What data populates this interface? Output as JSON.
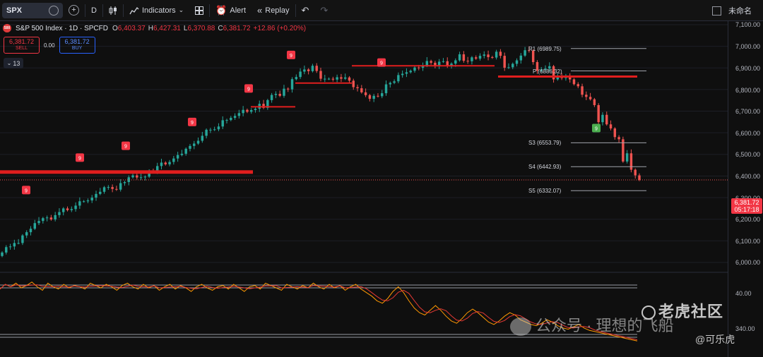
{
  "toolbar": {
    "symbol": "SPX",
    "interval": "D",
    "indicators_label": "Indicators",
    "alert_label": "Alert",
    "replay_label": "Replay",
    "layout_name": "未命名"
  },
  "legend": {
    "logo_text": "500",
    "title": "S&P 500 Index · 1D · SPCFD",
    "open_key": "O",
    "open": "6,403.37",
    "high_key": "H",
    "high": "6,427.31",
    "low_key": "L",
    "low": "6,370.88",
    "close_key": "C",
    "close": "6,381.72",
    "change": "+12.86 (+0.20%)",
    "sell_price": "6,381.72",
    "sell_label": "SELL",
    "spread": "0.00",
    "buy_price": "6,381.72",
    "buy_label": "BUY",
    "indicator_count": "13"
  },
  "price_axis": {
    "labels": [
      "7,100.00",
      "7,000.00",
      "6,900.00",
      "6,800.00",
      "6,700.00",
      "6,600.00",
      "6,500.00",
      "6,400.00",
      "6,300.00",
      "6,200.00",
      "6,100.00",
      "6,000.00"
    ],
    "current_price": "6,381.72",
    "countdown": "05:17:18"
  },
  "oscillator_axis": {
    "labels": [
      "40.00",
      "340.00"
    ]
  },
  "pivots": {
    "r1": "R1 (6989.75)",
    "p": "P (6886.32)",
    "s3": "S3 (6553.79)",
    "s4": "S4 (6442.93)",
    "s5": "S5 (6332.07)"
  },
  "signal_marker": "9",
  "watermark": {
    "main": "老虎社区",
    "sub": "公众号 · 理想的飞船",
    "author": "@可乐虎"
  },
  "colors": {
    "up": "#26a69a",
    "down": "#ef5350",
    "level_red": "#e01e1e",
    "signal_red": "#f23645",
    "signal_green": "#4caf50",
    "osc_orange": "#ff9800",
    "osc_red": "#e53935"
  },
  "chart_data": {
    "type": "candlestick",
    "series": [
      {
        "name": "SPX",
        "o": [
          6030,
          6046,
          6071,
          6074,
          6090,
          6090,
          6125,
          6140,
          6156,
          6182,
          6192,
          6205,
          6208,
          6199,
          6219,
          6233,
          6250,
          6242,
          6247,
          6263,
          6283,
          6283,
          6287,
          6300,
          6317,
          6327,
          6348,
          6349,
          6340,
          6337,
          6367,
          6372,
          6394,
          6403,
          6393,
          6394,
          6397,
          6422,
          6421,
          6446,
          6462,
          6454,
          6465,
          6481,
          6497,
          6503,
          6526,
          6539,
          6550,
          6563,
          6586,
          6614,
          6614,
          6616,
          6629,
          6658,
          6659,
          6669,
          6678,
          6691,
          6706,
          6697,
          6705,
          6711,
          6734,
          6715,
          6751,
          6775,
          6780,
          6771,
          6804,
          6801,
          6848,
          6858,
          6883,
          6893,
          6885,
          6910,
          6886,
          6850,
          6850,
          6850,
          6846,
          6857,
          6850,
          6856,
          6841,
          6811,
          6806,
          6787,
          6774,
          6757,
          6771,
          6769,
          6783,
          6824,
          6831,
          6838,
          6867,
          6873,
          6880,
          6887,
          6902,
          6901,
          6910,
          6932,
          6924,
          6910,
          6929,
          6931,
          6909,
          6920,
          6935,
          6963,
          6933,
          6931,
          6949,
          6943,
          6956,
          6962,
          6950,
          6948,
          6975,
          6956,
          6901,
          6903,
          6919,
          6935,
          6957,
          6982,
          6980,
          6927,
          6887,
          6892,
          6897,
          6908,
          6847,
          6864,
          6853,
          6857,
          6847,
          6825,
          6815,
          6776,
          6766,
          6755,
          6728,
          6649,
          6683,
          6639,
          6620,
          6580,
          6570,
          6467,
          6505,
          6429,
          6403
        ],
        "c": [
          6046,
          6071,
          6074,
          6090,
          6090,
          6125,
          6140,
          6156,
          6182,
          6192,
          6205,
          6208,
          6199,
          6219,
          6233,
          6250,
          6242,
          6247,
          6263,
          6283,
          6283,
          6287,
          6300,
          6317,
          6327,
          6348,
          6349,
          6340,
          6337,
          6367,
          6372,
          6394,
          6403,
          6393,
          6394,
          6397,
          6422,
          6421,
          6446,
          6462,
          6454,
          6465,
          6481,
          6497,
          6503,
          6526,
          6539,
          6550,
          6563,
          6586,
          6614,
          6614,
          6616,
          6629,
          6658,
          6659,
          6669,
          6678,
          6691,
          6706,
          6697,
          6705,
          6711,
          6734,
          6715,
          6751,
          6775,
          6780,
          6771,
          6804,
          6801,
          6848,
          6858,
          6883,
          6893,
          6885,
          6910,
          6886,
          6850,
          6850,
          6850,
          6846,
          6857,
          6850,
          6856,
          6841,
          6811,
          6806,
          6787,
          6774,
          6757,
          6771,
          6769,
          6783,
          6824,
          6831,
          6838,
          6867,
          6873,
          6880,
          6887,
          6902,
          6901,
          6910,
          6932,
          6924,
          6910,
          6929,
          6931,
          6909,
          6920,
          6935,
          6963,
          6933,
          6931,
          6949,
          6943,
          6956,
          6962,
          6950,
          6948,
          6975,
          6956,
          6901,
          6903,
          6919,
          6935,
          6957,
          6982,
          6980,
          6927,
          6887,
          6892,
          6897,
          6908,
          6847,
          6864,
          6853,
          6857,
          6847,
          6825,
          6815,
          6776,
          6766,
          6755,
          6728,
          6649,
          6683,
          6639,
          6620,
          6580,
          6570,
          6467,
          6505,
          6429,
          6403,
          6382
        ]
      },
      {
        "name": "oscillator",
        "values": [
          58,
          62,
          60,
          63,
          59,
          61,
          64,
          60,
          57,
          63,
          60,
          58,
          62,
          59,
          61,
          60,
          58,
          63,
          61,
          59,
          62,
          60,
          57,
          61,
          63,
          60,
          58,
          62,
          59,
          61,
          57,
          60,
          62,
          58,
          61,
          59,
          56,
          60,
          62,
          59,
          57,
          60,
          61,
          58,
          62,
          59,
          56,
          60,
          61,
          58,
          63,
          61,
          59,
          57,
          62,
          60,
          58,
          61,
          59,
          63,
          60,
          58,
          62,
          59,
          61,
          57,
          60,
          62,
          58,
          55,
          52,
          48,
          46,
          50,
          56,
          60,
          55,
          48,
          42,
          38,
          36,
          40,
          44,
          40,
          35,
          31,
          29,
          33,
          38,
          41,
          38,
          34,
          30,
          28,
          31,
          35,
          38,
          36,
          32,
          30,
          28,
          27,
          29,
          32,
          30,
          27,
          25,
          24,
          26,
          28,
          25,
          23,
          22,
          21,
          20,
          19,
          18,
          17,
          16,
          15,
          14
        ]
      }
    ],
    "ylim": [
      6000,
      7100
    ],
    "levels": [
      6420,
      6720,
      6830,
      6910,
      6860
    ],
    "pivot_levels": {
      "R1": 6989.75,
      "P": 6886.32,
      "S3": 6553.79,
      "S4": 6442.93,
      "S5": 6332.07
    }
  }
}
